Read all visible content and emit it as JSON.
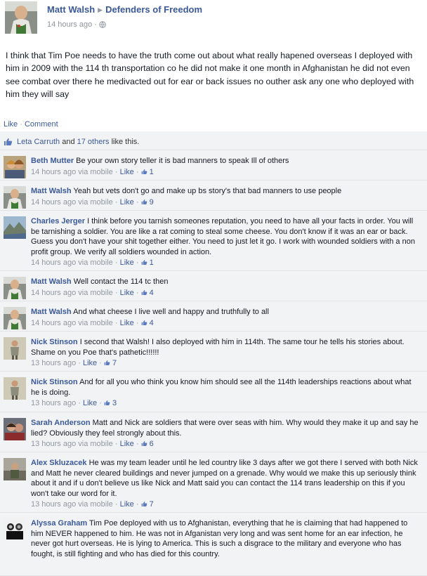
{
  "post": {
    "author": "Matt Walsh",
    "group": "Defenders of Freedom",
    "time": "14 hours ago",
    "separator": "·",
    "body": "I think that Tim Poe needs to have the truth come out about what really hapened overseas I deployed with him in 2009 with the 114 th transportation co he did not make it one month in Afghanistan he did not even see combat over there he medivacted out for ear or back issues no outher ask any one who deployed with him they will say",
    "actions": {
      "like": "Like",
      "comment": "Comment",
      "dot": "·"
    }
  },
  "likes": {
    "first": "Leta Carruth",
    "and": "and",
    "others": "17 others",
    "suffix": "like this."
  },
  "comments": [
    {
      "author": "Beth Mutter",
      "text": "Be your own story teller it is bad manners to speak Ill of others",
      "time": "14 hours ago via mobile",
      "like": "Like",
      "count": "1",
      "avatar": "couple"
    },
    {
      "author": "Matt Walsh",
      "text": "Yeah but vets don't go and make up bs story's that bad manners to use people",
      "time": "14 hours ago via mobile",
      "like": "Like",
      "count": "9",
      "avatar": "matt"
    },
    {
      "author": "Charles Jerger",
      "text": "I think before you tarnish someones reputation, you need to have all your facts in order. You will be tarnishing a soldier. You are like a rat coming to steal some cheese. You don't know if it was an ear or back. Guess you don't have your shit together either. You need to just let it go. I work with wounded soldiers with a non profit group. We verify all soldiers wounded in action.",
      "time": "14 hours ago via mobile",
      "like": "Like",
      "count": "1",
      "avatar": "mountain"
    },
    {
      "author": "Matt Walsh",
      "text": "Well contact the 114 tc then",
      "time": "14 hours ago via mobile",
      "like": "Like",
      "count": "4",
      "avatar": "matt"
    },
    {
      "author": "Matt Walsh",
      "text": "And what cheese I live well and happy and truthfully to all",
      "time": "14 hours ago via mobile",
      "like": "Like",
      "count": "4",
      "avatar": "matt"
    },
    {
      "author": "Nick Stinson",
      "text": "I second that Walsh! I also deployed with him in 114th. The same tour he tells his stories about. Shame on you Poe that's pathetic!!!!!!",
      "time": "13 hours ago",
      "like": "Like",
      "count": "7",
      "avatar": "nick"
    },
    {
      "author": "Nick Stinson",
      "text": "And for all you who think you know him should see all the 114th leaderships reactions about what he is doing.",
      "time": "13 hours ago",
      "like": "Like",
      "count": "3",
      "avatar": "nick"
    },
    {
      "author": "Sarah Anderson",
      "text": "Matt and Nick are soldiers that were over seas with him. Why would they make it up and say he lied? Obviously they feel strongly about this.",
      "time": "13 hours ago via mobile",
      "like": "Like",
      "count": "6",
      "avatar": "sarah"
    },
    {
      "author": "Alex Skluzacek",
      "text": "He was my team leader until he led country like 3 days after we got there I served with both Nick and Matt he never cleared buildings and never jumped on a grenade. Why would we make this up seriously think about it and if u don't believe us like Nick and Matt said you can contact the 114 trans leadership on this if you won't take our word for it.",
      "time": "13 hours ago via mobile",
      "like": "Like",
      "count": "7",
      "avatar": "alex"
    },
    {
      "author": "Alyssa Graham",
      "text": "Tim Poe deployed with us to Afghanistan, everything that he is claiming that had happened to him NEVER happened to him. He was not in Afganistan very long and was sent home for an ear infection, he never got hurt overseas. He is lying to America. This is such a disgrace to the military and everyone who has fought, is still fighting and who has died for this country.",
      "time": "",
      "like": "",
      "count": "",
      "avatar": "alyssa"
    }
  ]
}
